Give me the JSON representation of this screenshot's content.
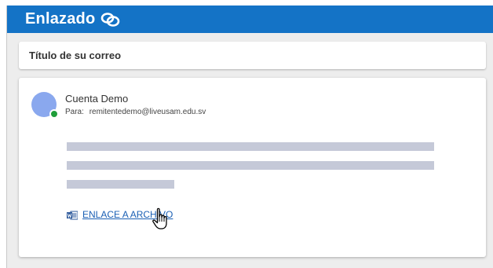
{
  "app": {
    "title": "Enlazado",
    "logo_icon": "link-icon",
    "header_color": "#1473c6"
  },
  "subject": {
    "text": "Título de su correo"
  },
  "message": {
    "sender_name": "Cuenta Demo",
    "recipient_label": "Para:",
    "recipient_email": "remitentedemo@liveusam.edu.sv",
    "avatar_color": "#8aa8ee",
    "presence_color": "#1f9e3a",
    "presence_status": "online",
    "placeholder_color": "#c5c9d8"
  },
  "attachment": {
    "icon": "word-document-icon",
    "label": "ENLACE A ARCHIVO",
    "link_color": "#1a5fb4"
  },
  "pointer": {
    "icon": "hand-pointer-cursor-icon"
  }
}
